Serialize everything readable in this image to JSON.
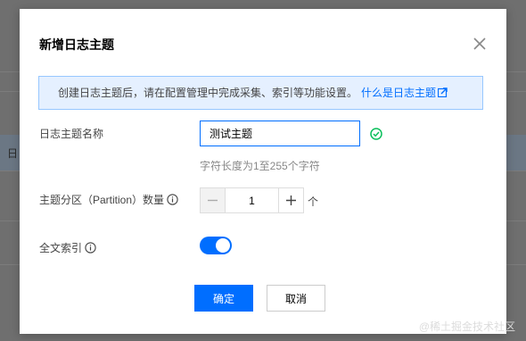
{
  "background": {
    "row_text": "日"
  },
  "dialog": {
    "title": "新增日志主题",
    "close_icon": "close-icon",
    "notice": {
      "text": "创建日志主题后，请在配置管理中完成采集、索引等功能设置。",
      "link_text": "什么是日志主题",
      "link_icon": "external-link-icon"
    },
    "form": {
      "topic_name": {
        "label": "日志主题名称",
        "value": "测试主题",
        "hint": "字符长度为1至255个字符",
        "status_icon": "check-circle-icon"
      },
      "partition": {
        "label": "主题分区（Partition）数量",
        "help_icon": "info-icon",
        "value": "1",
        "unit": "个",
        "minus_icon": "minus-icon",
        "plus_icon": "plus-icon"
      },
      "fulltext_index": {
        "label": "全文索引",
        "help_icon": "info-icon",
        "enabled": true
      }
    },
    "buttons": {
      "confirm": "确定",
      "cancel": "取消"
    }
  },
  "watermark": "@稀土掘金技术社区",
  "colors": {
    "primary": "#006eff",
    "success": "#0abf5b",
    "notice_bg": "#e5f0ff",
    "notice_border": "#97c7ff"
  }
}
